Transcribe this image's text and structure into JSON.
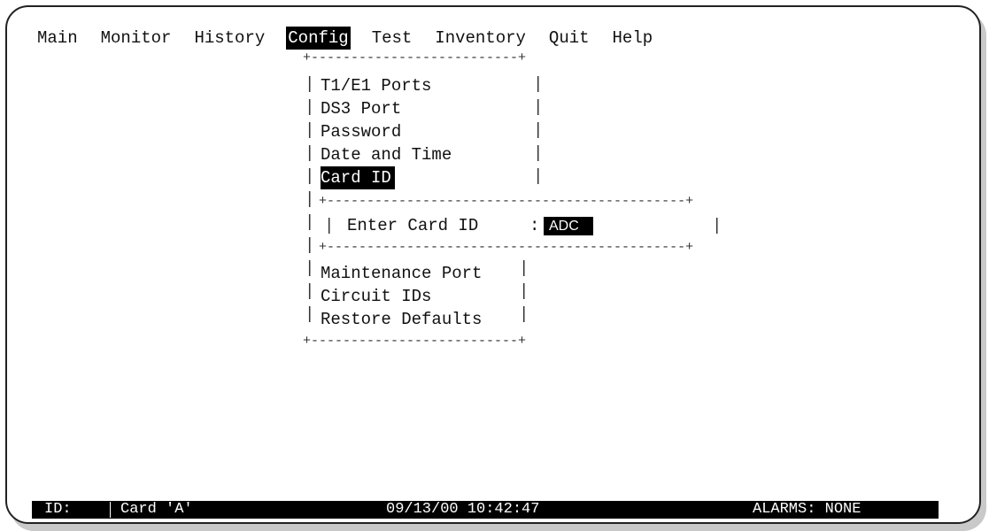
{
  "menu_bar": {
    "items": [
      "Main",
      "Monitor",
      "History",
      "Config",
      "Test",
      "Inventory",
      "Quit",
      "Help"
    ],
    "selected": "Config"
  },
  "config_menu": {
    "items": [
      "T1/E1 Ports",
      "DS3 Port",
      "Password",
      "Date and Time",
      "Card ID",
      "Maintenance Port",
      "Circuit IDs",
      "Restore Defaults"
    ],
    "selected": "Card ID"
  },
  "card_id_dialog": {
    "label": "Enter Card ID",
    "separator": ":",
    "value": "ADC"
  },
  "status_bar": {
    "id_label": "ID:",
    "card": "Card 'A'",
    "datetime": "09/13/00 10:42:47",
    "alarms": "ALARMS: NONE"
  }
}
